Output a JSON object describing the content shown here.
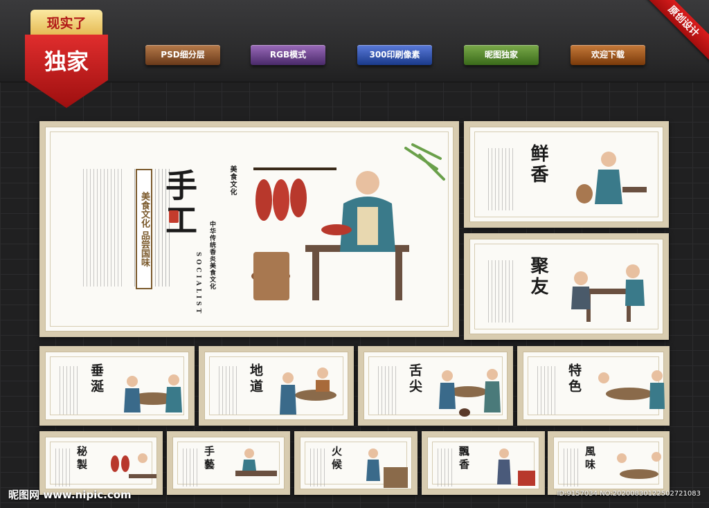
{
  "badge": {
    "top": "现实了",
    "main": "独家"
  },
  "ribbon": "原创设计",
  "buttons": [
    {
      "label": "PSD细分层",
      "color": "#7a4a2a"
    },
    {
      "label": "RGB模式",
      "color": "#6a3a8a"
    },
    {
      "label": "300印刷像素",
      "color": "#2a4a9a"
    },
    {
      "label": "昵图独家",
      "color": "#4a7a2a"
    },
    {
      "label": "欢迎下载",
      "color": "#8a4a1a"
    }
  ],
  "main_panel": {
    "title": "手工",
    "subtitle": "美食文化 品尝国味",
    "tag": "美食文化",
    "socialist": "SOCIALIST",
    "vertical_text": "中华传统香炎美食文化"
  },
  "panels": [
    {
      "title": "鲜香"
    },
    {
      "title": "聚友"
    },
    {
      "title": "垂涎"
    },
    {
      "title": "地道"
    },
    {
      "title": "舌尖"
    },
    {
      "title": "特色"
    },
    {
      "title": "秘製"
    },
    {
      "title": "手藝"
    },
    {
      "title": "火候"
    },
    {
      "title": "飄香"
    },
    {
      "title": "風味"
    }
  ],
  "footer": {
    "site": "昵图网 www.nipic.com",
    "id": "ID:9157034 NO:20200830122502721083"
  }
}
